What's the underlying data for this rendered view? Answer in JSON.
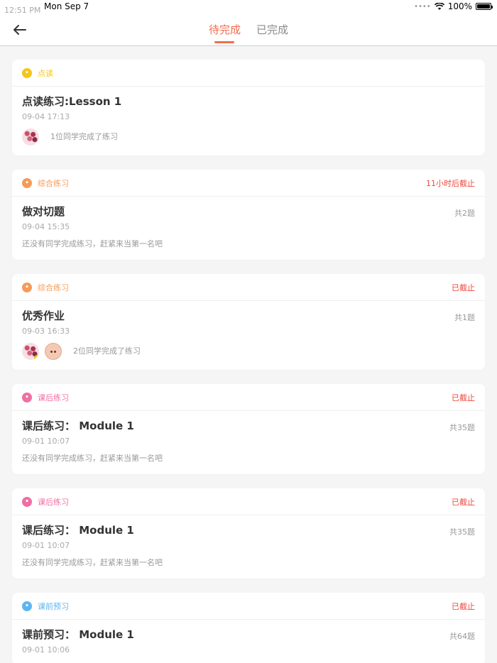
{
  "status_bar": {
    "time": "12:51 PM",
    "date": "Mon Sep 7",
    "battery": "100%"
  },
  "nav": {
    "back_icon": "arrow-left-icon",
    "tabs": [
      {
        "label": "待完成",
        "active": true
      },
      {
        "label": "已完成",
        "active": false
      }
    ]
  },
  "colors": {
    "accent": "#f26d4f",
    "danger": "#f0453a",
    "type_dudu": "#f5c518",
    "type_zonghe": "#f59b5a",
    "type_kehou": "#ef6fa3",
    "type_keqian": "#5cb5f0"
  },
  "cards": [
    {
      "type": "点读",
      "type_color": "#f5c518",
      "deadline": "",
      "title": "点读练习:Lesson 1",
      "qcount": "",
      "time": "09-04 17:13",
      "summary": "1位同学完成了练习",
      "avatars": [
        "flowers"
      ]
    },
    {
      "type": "综合练习",
      "type_color": "#f59b5a",
      "deadline": "11小时后截止",
      "title": "做对切题",
      "qcount": "共2题",
      "time": "09-04 15:35",
      "summary": "还没有同学完成练习，赶紧来当第一名吧",
      "avatars": []
    },
    {
      "type": "综合练习",
      "type_color": "#f59b5a",
      "deadline": "已截止",
      "title": "优秀作业",
      "qcount": "共1题",
      "time": "09-03 16:33",
      "summary": "2位同学完成了练习",
      "avatars": [
        "flowers",
        "face"
      ]
    },
    {
      "type": "课后练习",
      "type_color": "#ef6fa3",
      "deadline": "已截止",
      "title": "课后练习： Module 1",
      "qcount": "共35题",
      "time": "09-01 10:07",
      "summary": "还没有同学完成练习，赶紧来当第一名吧",
      "avatars": []
    },
    {
      "type": "课后练习",
      "type_color": "#ef6fa3",
      "deadline": "已截止",
      "title": "课后练习： Module 1",
      "qcount": "共35题",
      "time": "09-01 10:07",
      "summary": "还没有同学完成练习，赶紧来当第一名吧",
      "avatars": []
    },
    {
      "type": "课前预习",
      "type_color": "#5cb5f0",
      "deadline": "已截止",
      "title": "课前预习： Module 1",
      "qcount": "共64题",
      "time": "09-01 10:06",
      "summary": "",
      "avatars": []
    }
  ]
}
